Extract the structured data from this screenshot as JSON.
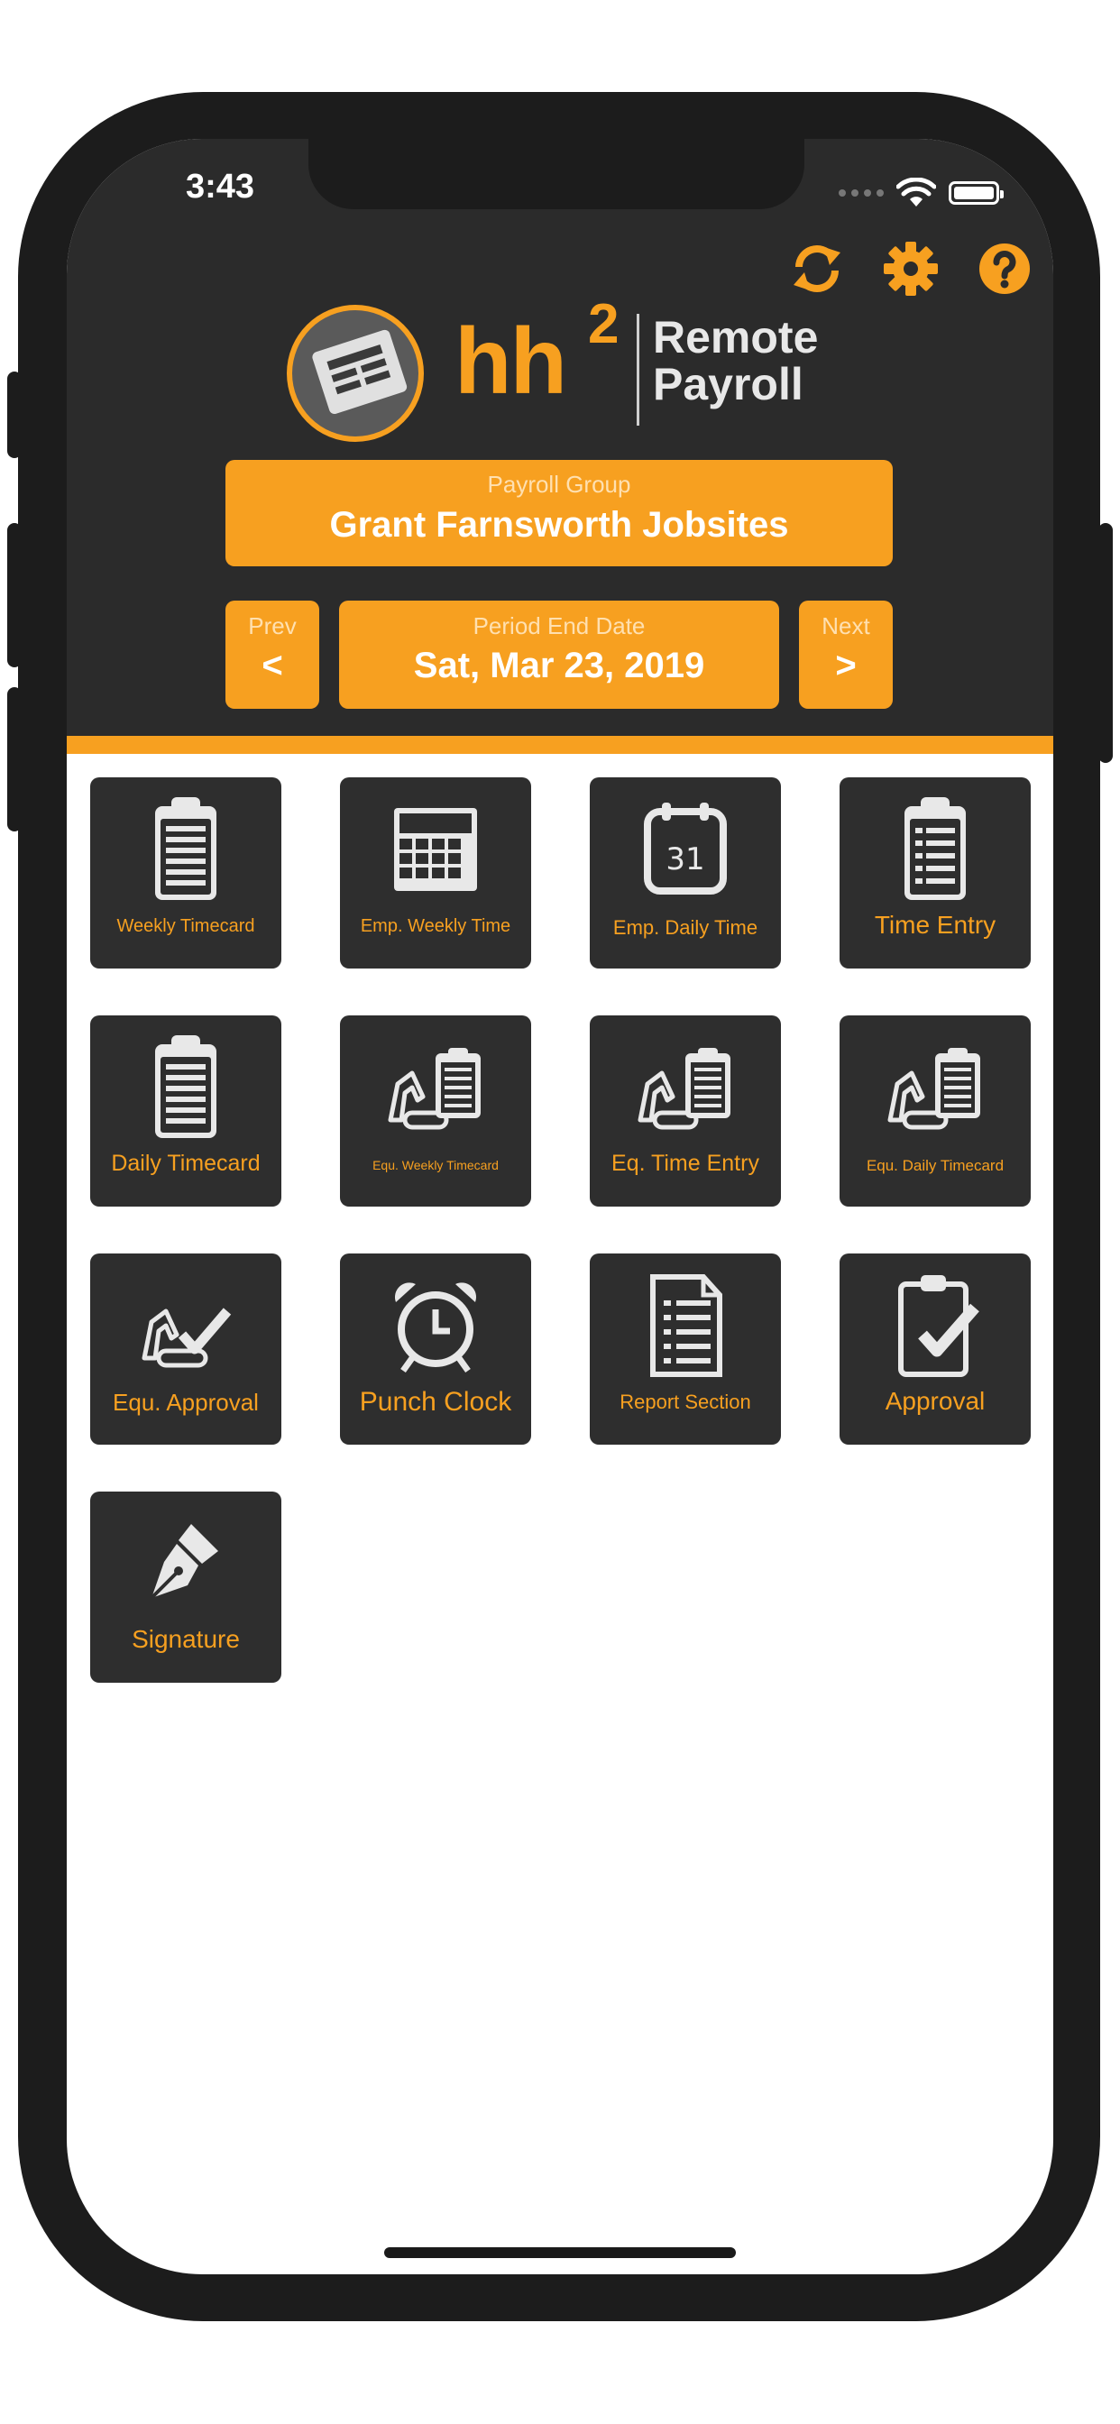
{
  "status_bar": {
    "time": "3:43"
  },
  "header": {
    "logo": {
      "hh": "hh",
      "sup": "2",
      "line1": "Remote",
      "line2": "Payroll"
    },
    "icons": [
      "refresh-icon",
      "gear-icon",
      "help-icon"
    ]
  },
  "payroll_group": {
    "caption": "Payroll Group",
    "value": "Grant Farnsworth Jobsites"
  },
  "period": {
    "prev_caption": "Prev",
    "prev_symbol": "<",
    "caption": "Period End Date",
    "value": "Sat, Mar 23, 2019",
    "next_caption": "Next",
    "next_symbol": ">"
  },
  "tiles": [
    {
      "label": "Weekly Timecard",
      "icon": "clipboard-icon"
    },
    {
      "label": "Emp. Weekly Time",
      "icon": "calendar-grid-icon"
    },
    {
      "label": "Emp. Daily Time",
      "icon": "calendar-day-icon",
      "icon_text": "31"
    },
    {
      "label": "Time Entry",
      "icon": "clipboard-list-icon"
    },
    {
      "label": "Daily Timecard",
      "icon": "clipboard-icon"
    },
    {
      "label": "Equ. Weekly Timecard",
      "icon": "excavator-clipboard-icon"
    },
    {
      "label": "Eq. Time Entry",
      "icon": "excavator-clipboard-icon"
    },
    {
      "label": "Equ. Daily Timecard",
      "icon": "excavator-clipboard-icon"
    },
    {
      "label": "Equ. Approval",
      "icon": "excavator-check-icon"
    },
    {
      "label": "Punch Clock",
      "icon": "alarm-clock-icon"
    },
    {
      "label": "Report Section",
      "icon": "document-icon"
    },
    {
      "label": "Approval",
      "icon": "clipboard-check-icon"
    },
    {
      "label": "Signature",
      "icon": "pen-nib-icon"
    }
  ],
  "colors": {
    "accent": "#f7a020",
    "header_bg": "#2b2b2b",
    "tile_bg": "#2e2e2e"
  }
}
